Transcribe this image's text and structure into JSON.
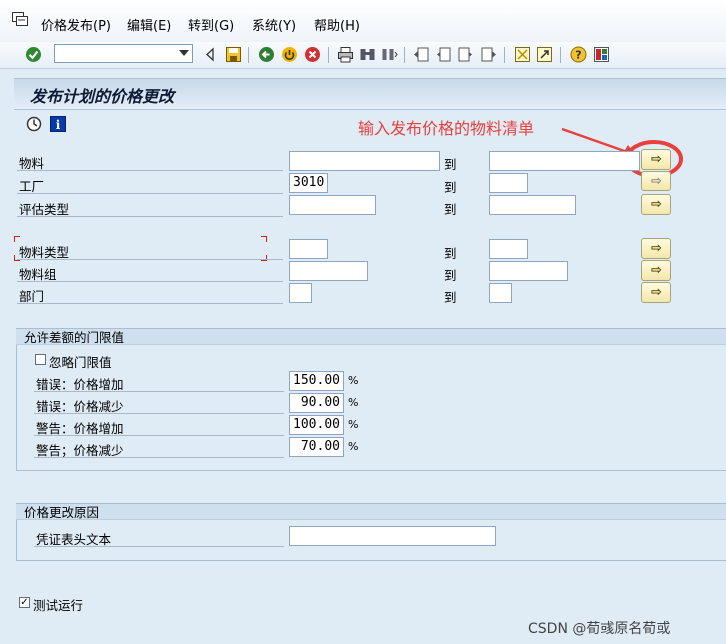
{
  "menu": {
    "items": [
      "价格发布(P)",
      "编辑(E)",
      "转到(G)",
      "系统(Y)",
      "帮助(H)"
    ]
  },
  "toolbar": {
    "command_value": ""
  },
  "title": "发布计划的价格更改",
  "selection": {
    "to_label": "到",
    "material_label": "物料",
    "plant_label": "工厂",
    "plant_value": "3010",
    "valuation_type_label": "评估类型",
    "material_type_label": "物料类型",
    "material_group_label": "物料组",
    "division_label": "部门"
  },
  "annotation": {
    "text": "输入发布价格的物料清单",
    "color": "#e8403c"
  },
  "tolerance": {
    "header": "允许差额的门限值",
    "ignore_label": "忽略门限值",
    "rows": [
      {
        "label": "错误：价格增加",
        "value": "150.00",
        "unit": "%"
      },
      {
        "label": "错误：价格减少",
        "value": "90.00",
        "unit": "%"
      },
      {
        "label": "警告：价格增加",
        "value": "100.00",
        "unit": "%"
      },
      {
        "label": "警告；价格减少",
        "value": "70.00",
        "unit": "%"
      }
    ]
  },
  "reason": {
    "header": "价格更改原因",
    "doc_header_label": "凭证表头文本",
    "doc_header_value": ""
  },
  "test_run": {
    "label": "测试运行",
    "checked": true
  },
  "watermark": "CSDN @荀彧原名荀或",
  "colors": {
    "accent": "#e8403c",
    "title_bg": "#c7d8ea",
    "page_bg": "#dfebf5"
  }
}
